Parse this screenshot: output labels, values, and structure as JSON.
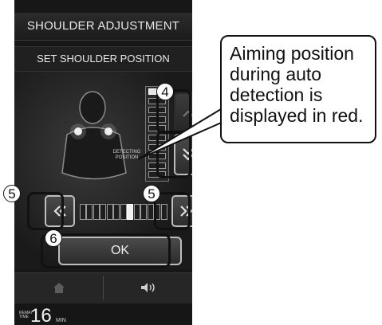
{
  "page": {
    "heading": "adjustment"
  },
  "screen": {
    "title": "SHOULDER ADJUSTMENT",
    "subtitle": "SET SHOULDER POSITION",
    "detecting_label": "DETECTING POSITION",
    "ok_label": "OK",
    "remaining": {
      "label": "REMAI TIME",
      "value": "16",
      "unit": "MIN"
    },
    "footer": {
      "home_icon": "home-icon",
      "volume_icon": "speaker-icon"
    },
    "vertical_meter": {
      "segments": 10,
      "highlighted_index": 0
    },
    "horizontal_meter": {
      "segments": 13,
      "highlighted_index": 7
    }
  },
  "annotations": {
    "up_down_number": "4",
    "left_number": "5",
    "right_number": "5",
    "ok_number": "6"
  },
  "callout": {
    "line1": "Aiming position",
    "line2": "during auto",
    "line3": "detection is",
    "line4": "displayed in red."
  },
  "colors": {
    "screen_bg": "#171717",
    "button_border": "#bdbdbd",
    "text_light": "#e8e8e8"
  }
}
